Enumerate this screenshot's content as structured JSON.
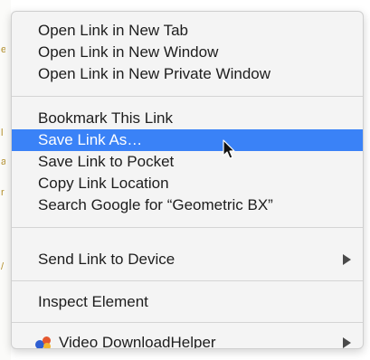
{
  "menu": {
    "groups": [
      [
        "Open Link in New Tab",
        "Open Link in New Window",
        "Open Link in New Private Window"
      ],
      [
        "Bookmark This Link",
        "Save Link As…",
        "Save Link to Pocket",
        "Copy Link Location",
        "Search Google for “Geometric BX”"
      ],
      [
        "Send Link to Device"
      ],
      [
        "Inspect Element"
      ],
      [
        "Video DownloadHelper"
      ]
    ],
    "highlighted": "Save Link As…",
    "submenu_items": [
      "Send Link to Device",
      "Video DownloadHelper"
    ],
    "addon_icon": "video-downloadhelper-icon"
  },
  "colors": {
    "menu_bg": "#f4f4f4",
    "highlight": "#3a82f7",
    "text": "#1d1d1d",
    "highlight_text": "#ffffff",
    "separator": "#d4d4d4"
  }
}
